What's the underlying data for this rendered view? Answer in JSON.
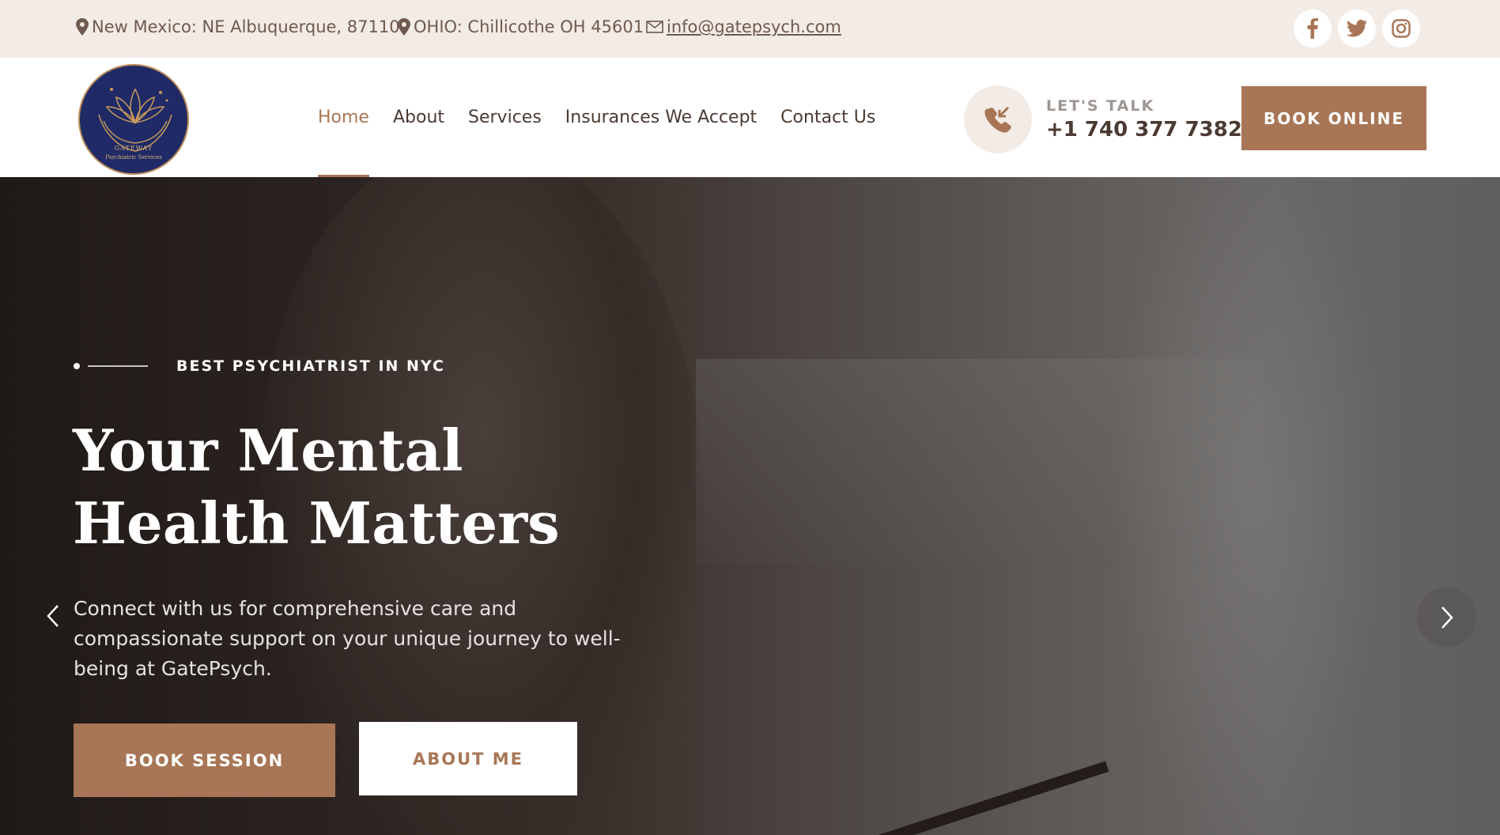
{
  "topbar": {
    "location1": "New Mexico: NE Albuquerque, 87110",
    "location2": "OHIO: Chillicothe OH 45601",
    "email": "info@gatepsych.com",
    "social": [
      "facebook-icon",
      "twitter-icon",
      "instagram-icon"
    ]
  },
  "header": {
    "logo_text_1": "GATEWAY",
    "logo_text_2": "Psychiatric Services",
    "nav": [
      {
        "label": "Home",
        "active": true
      },
      {
        "label": "About"
      },
      {
        "label": "Services"
      },
      {
        "label": "Insurances We Accept"
      },
      {
        "label": "Contact Us"
      }
    ],
    "talk_label": "LET'S TALK",
    "phone": "+1 740 377 7382",
    "book_online": "BOOK ONLINE"
  },
  "hero": {
    "eyebrow": "BEST PSYCHIATRIST IN NYC",
    "headline": "Your Mental Health Matters",
    "subtext": "Connect with us for comprehensive care and compassionate support on your unique journey to well-being at GatePsych.",
    "btn_book": "BOOK SESSION",
    "btn_about": "ABOUT ME"
  },
  "colors": {
    "accent": "#a87656",
    "topbar_bg": "#f3ebe5",
    "logo_bg": "#1f2a66"
  }
}
